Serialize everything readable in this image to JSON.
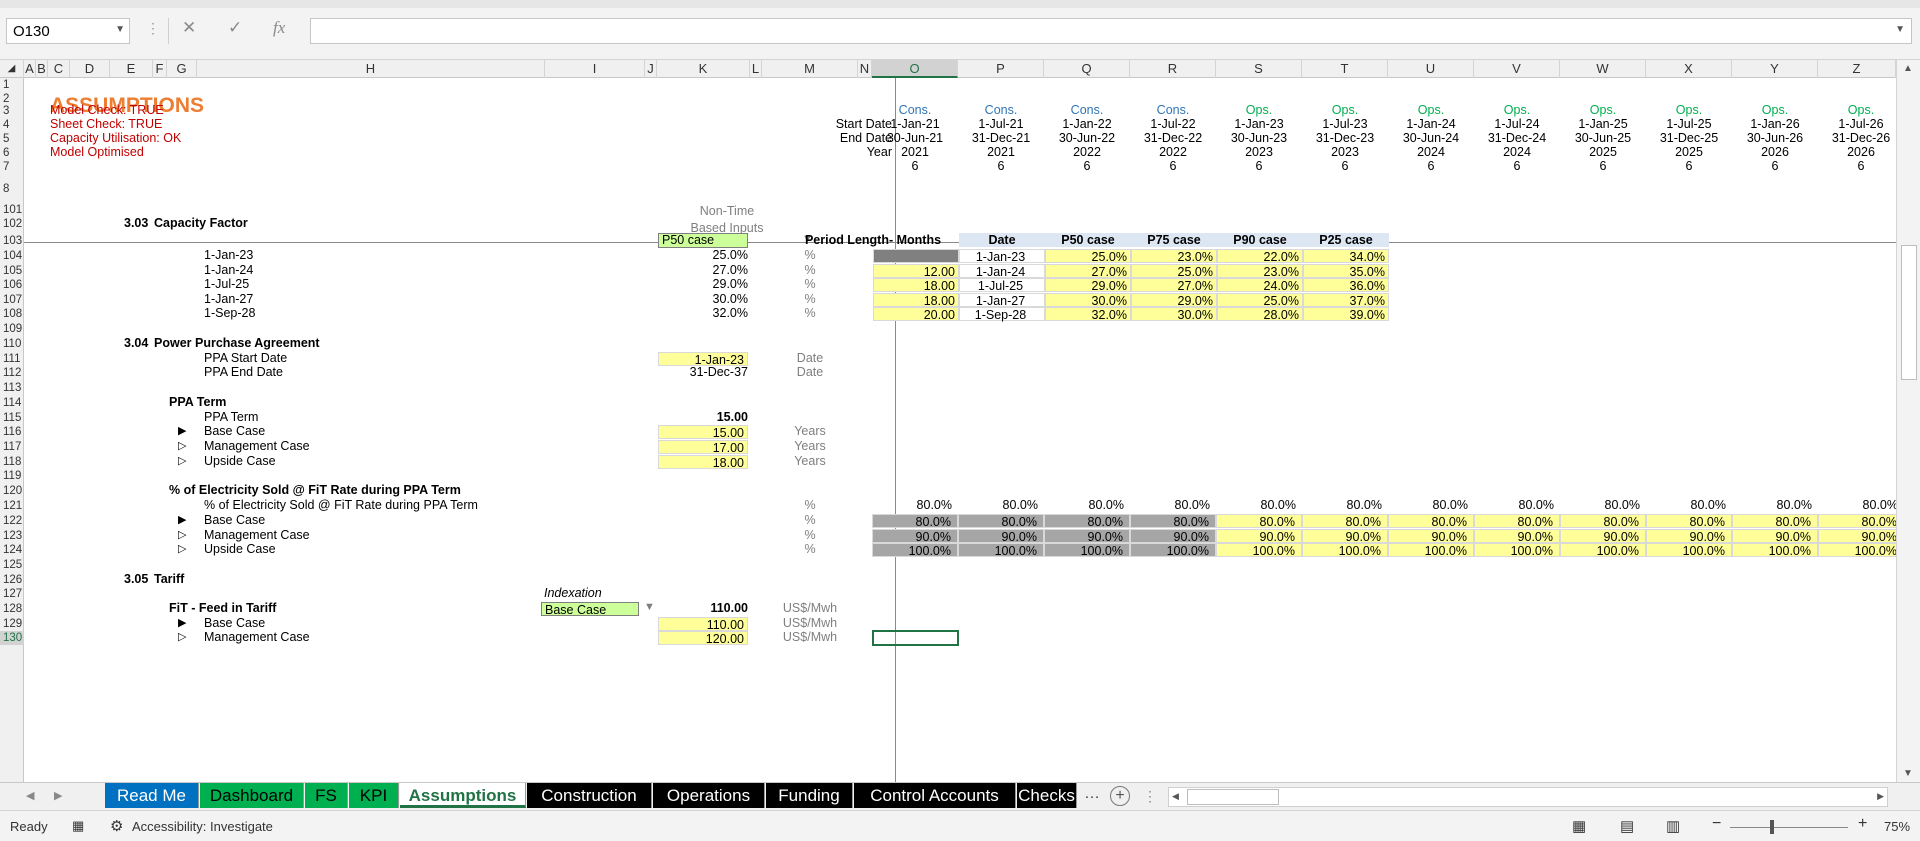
{
  "formula_bar": {
    "name_box": "O130",
    "cancel_icon": "✕",
    "enter_icon": "✓",
    "fx_label": "fx",
    "formula": ""
  },
  "columns": [
    "A",
    "B",
    "C",
    "D",
    "E",
    "F",
    "G",
    "H",
    "I",
    "J",
    "K",
    "L",
    "M",
    "N",
    "O",
    "P",
    "Q",
    "R",
    "S",
    "T",
    "U",
    "V",
    "W",
    "X",
    "Y",
    "Z"
  ],
  "rows": [
    "1",
    "2",
    "3",
    "4",
    "5",
    "6",
    "7",
    "8",
    "101",
    "102",
    "103",
    "104",
    "105",
    "106",
    "107",
    "108",
    "109",
    "110",
    "111",
    "112",
    "113",
    "114",
    "115",
    "116",
    "117",
    "118",
    "119",
    "120",
    "121",
    "122",
    "123",
    "124",
    "125",
    "126",
    "127",
    "128",
    "129",
    "130"
  ],
  "header": {
    "title": "ASSUMPTIONS",
    "checks": [
      "Model Check: TRUE",
      "Sheet Check: TRUE",
      "Capacity Utilisation: OK",
      "Model Optimised"
    ],
    "timeline_labels": [
      "Start Date",
      "End Date",
      "Year"
    ],
    "non_time_label_1": "Non-Time",
    "non_time_label_2": "Based Inputs",
    "periods": [
      {
        "phase": "Cons.",
        "start": "1-Jan-21",
        "end": "30-Jun-21",
        "year": "2021",
        "months": "6"
      },
      {
        "phase": "Cons.",
        "start": "1-Jul-21",
        "end": "31-Dec-21",
        "year": "2021",
        "months": "6"
      },
      {
        "phase": "Cons.",
        "start": "1-Jan-22",
        "end": "30-Jun-22",
        "year": "2022",
        "months": "6"
      },
      {
        "phase": "Cons.",
        "start": "1-Jul-22",
        "end": "31-Dec-22",
        "year": "2022",
        "months": "6"
      },
      {
        "phase": "Ops.",
        "start": "1-Jan-23",
        "end": "30-Jun-23",
        "year": "2023",
        "months": "6"
      },
      {
        "phase": "Ops.",
        "start": "1-Jul-23",
        "end": "31-Dec-23",
        "year": "2023",
        "months": "6"
      },
      {
        "phase": "Ops.",
        "start": "1-Jan-24",
        "end": "30-Jun-24",
        "year": "2024",
        "months": "6"
      },
      {
        "phase": "Ops.",
        "start": "1-Jul-24",
        "end": "31-Dec-24",
        "year": "2024",
        "months": "6"
      },
      {
        "phase": "Ops.",
        "start": "1-Jan-25",
        "end": "30-Jun-25",
        "year": "2025",
        "months": "6"
      },
      {
        "phase": "Ops.",
        "start": "1-Jul-25",
        "end": "31-Dec-25",
        "year": "2025",
        "months": "6"
      },
      {
        "phase": "Ops.",
        "start": "1-Jan-26",
        "end": "30-Jun-26",
        "year": "2026",
        "months": "6"
      },
      {
        "phase": "Ops.",
        "start": "1-Jul-26",
        "end": "31-Dec-26",
        "year": "2026",
        "months": "6"
      }
    ]
  },
  "capacity_factor": {
    "section_num": "3.03",
    "section_title": "Capacity Factor",
    "case_select": "P50 case",
    "dropdown_icon": "▼",
    "rows": [
      {
        "date": "1-Jan-23",
        "value": "25.0%",
        "unit": "%"
      },
      {
        "date": "1-Jan-24",
        "value": "27.0%",
        "unit": "%"
      },
      {
        "date": "1-Jul-25",
        "value": "29.0%",
        "unit": "%"
      },
      {
        "date": "1-Jan-27",
        "value": "30.0%",
        "unit": "%"
      },
      {
        "date": "1-Sep-28",
        "value": "32.0%",
        "unit": "%"
      }
    ],
    "table_headers": [
      "Period Length- Months",
      "Date",
      "P50 case",
      "P75 case",
      "P90 case",
      "P25 case"
    ],
    "table_rows": [
      {
        "months": "",
        "date": "1-Jan-23",
        "p50": "25.0%",
        "p75": "23.0%",
        "p90": "22.0%",
        "p25": "34.0%"
      },
      {
        "months": "12.00",
        "date": "1-Jan-24",
        "p50": "27.0%",
        "p75": "25.0%",
        "p90": "23.0%",
        "p25": "35.0%"
      },
      {
        "months": "18.00",
        "date": "1-Jul-25",
        "p50": "29.0%",
        "p75": "27.0%",
        "p90": "24.0%",
        "p25": "36.0%"
      },
      {
        "months": "18.00",
        "date": "1-Jan-27",
        "p50": "30.0%",
        "p75": "29.0%",
        "p90": "25.0%",
        "p25": "37.0%"
      },
      {
        "months": "20.00",
        "date": "1-Sep-28",
        "p50": "32.0%",
        "p75": "30.0%",
        "p90": "28.0%",
        "p25": "39.0%"
      }
    ]
  },
  "ppa": {
    "section_num": "3.04",
    "section_title": "Power Purchase Agreement",
    "start_label": "PPA Start Date",
    "start_value": "1-Jan-23",
    "start_unit": "Date",
    "end_label": "PPA End Date",
    "end_value": "31-Dec-37",
    "end_unit": "Date",
    "term_heading": "PPA Term",
    "term_label": "PPA Term",
    "term_value": "15.00",
    "cases": [
      {
        "marker": "▶",
        "label": "Base Case",
        "value": "15.00",
        "unit": "Years"
      },
      {
        "marker": "▷",
        "label": "Management Case",
        "value": "17.00",
        "unit": "Years"
      },
      {
        "marker": "▷",
        "label": "Upside Case",
        "value": "18.00",
        "unit": "Years"
      }
    ]
  },
  "electricity_sold": {
    "heading": "% of Electricity Sold @ FiT Rate during PPA Term",
    "label": "% of Electricity Sold @ FiT Rate during PPA Term",
    "unit": "%",
    "main_values": [
      "80.0%",
      "80.0%",
      "80.0%",
      "80.0%",
      "80.0%",
      "80.0%",
      "80.0%",
      "80.0%",
      "80.0%",
      "80.0%",
      "80.0%",
      "80.0%"
    ],
    "cases": [
      {
        "marker": "▶",
        "label": "Base Case",
        "unit": "%",
        "values": [
          "80.0%",
          "80.0%",
          "80.0%",
          "80.0%",
          "80.0%",
          "80.0%",
          "80.0%",
          "80.0%",
          "80.0%",
          "80.0%",
          "80.0%",
          "80.0%"
        ]
      },
      {
        "marker": "▷",
        "label": "Management Case",
        "unit": "%",
        "values": [
          "90.0%",
          "90.0%",
          "90.0%",
          "90.0%",
          "90.0%",
          "90.0%",
          "90.0%",
          "90.0%",
          "90.0%",
          "90.0%",
          "90.0%",
          "90.0%"
        ]
      },
      {
        "marker": "▷",
        "label": "Upside Case",
        "unit": "%",
        "values": [
          "100.0%",
          "100.0%",
          "100.0%",
          "100.0%",
          "100.0%",
          "100.0%",
          "100.0%",
          "100.0%",
          "100.0%",
          "100.0%",
          "100.0%",
          "100.0%"
        ]
      }
    ]
  },
  "tariff": {
    "section_num": "3.05",
    "section_title": "Tariff",
    "indexation_label": "Indexation",
    "indexation_select": "Base Case",
    "fit_label": "FiT - Feed in Tariff",
    "fit_value": "110.00",
    "fit_unit": "US$/Mwh",
    "cases": [
      {
        "marker": "▶",
        "label": "Base Case",
        "value": "110.00",
        "unit": "US$/Mwh"
      },
      {
        "marker": "▷",
        "label": "Management Case",
        "value": "120.00",
        "unit": "US$/Mwh"
      }
    ]
  },
  "sheet_tabs": [
    "Read Me",
    "Dashboard",
    "FS",
    "KPI",
    "Assumptions",
    "Construction",
    "Operations",
    "Funding",
    "Control Accounts",
    "Checks"
  ],
  "status": {
    "ready": "Ready",
    "accessibility": "Accessibility: Investigate",
    "zoom": "75%"
  },
  "colors": {
    "title_orange": "#ed7d31",
    "check_red": "#c00000",
    "cons_blue": "#2e75b6",
    "ops_green": "#00b050",
    "input_yellow": "#ffff99",
    "select_green": "#ccff99",
    "header_blue": "#dde7f4",
    "grey_cell": "#a6a6a6"
  }
}
